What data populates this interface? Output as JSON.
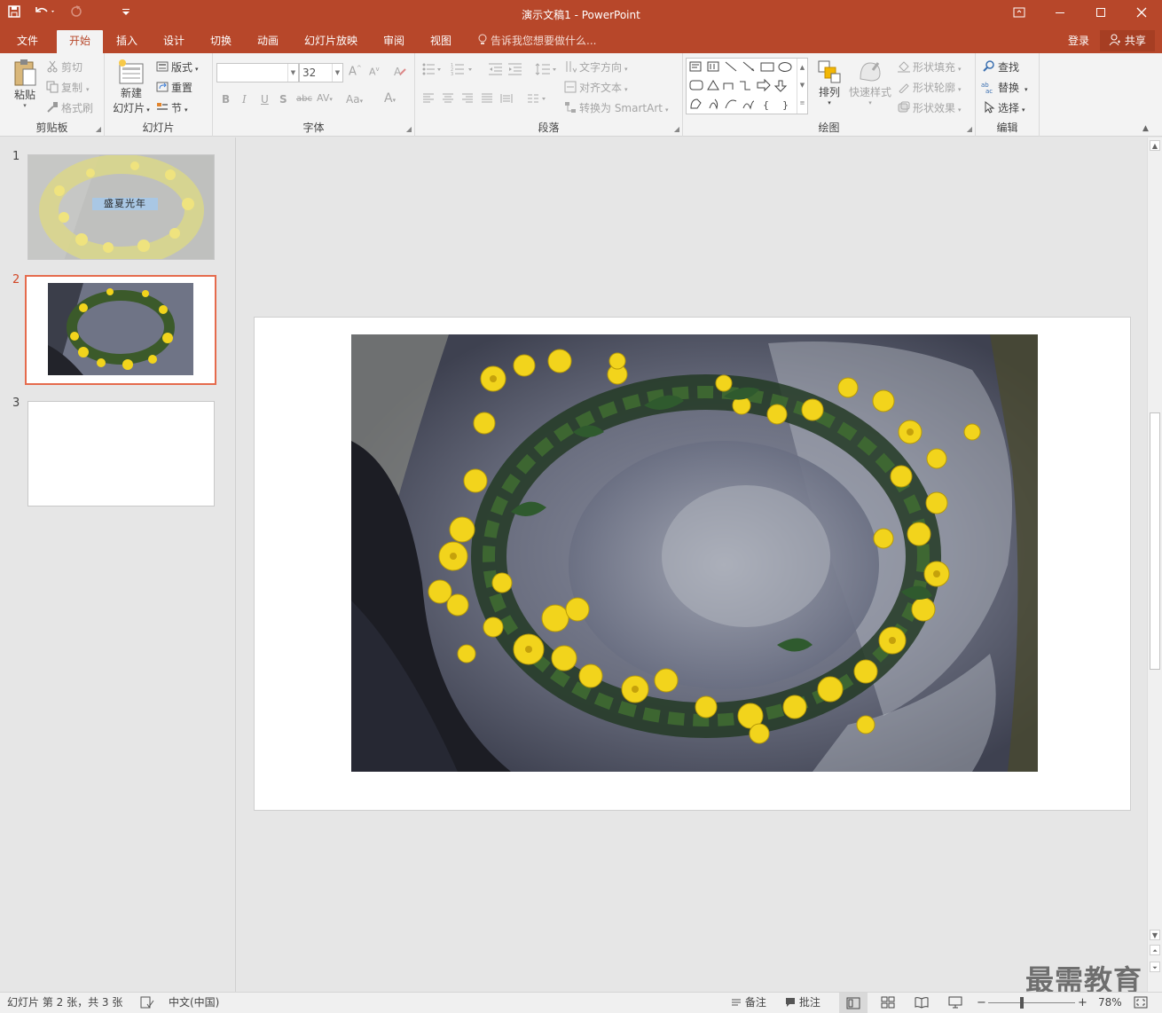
{
  "titlebar": {
    "title": "演示文稿1 - PowerPoint",
    "qat": [
      "save-icon",
      "undo-icon",
      "redo-icon",
      "customize-qat-icon"
    ],
    "window_buttons": [
      "ribbon-display-icon",
      "minimize-icon",
      "maximize-icon",
      "close-icon"
    ]
  },
  "tabs": {
    "items": [
      {
        "label": "文件",
        "active": false
      },
      {
        "label": "开始",
        "active": true
      },
      {
        "label": "插入",
        "active": false
      },
      {
        "label": "设计",
        "active": false
      },
      {
        "label": "切换",
        "active": false
      },
      {
        "label": "动画",
        "active": false
      },
      {
        "label": "幻灯片放映",
        "active": false
      },
      {
        "label": "审阅",
        "active": false
      },
      {
        "label": "视图",
        "active": false
      }
    ],
    "tell_me": "告诉我您想要做什么...",
    "login": "登录",
    "share": "共享"
  },
  "ribbon": {
    "clipboard": {
      "label": "剪贴板",
      "paste": "粘贴",
      "cut": "剪切",
      "copy": "复制",
      "format_painter": "格式刷"
    },
    "slides": {
      "label": "幻灯片",
      "new_slide_line1": "新建",
      "new_slide_line2": "幻灯片",
      "layout": "版式",
      "reset": "重置",
      "section": "节"
    },
    "font": {
      "label": "字体",
      "font_name": "",
      "font_size": "32"
    },
    "paragraph": {
      "label": "段落",
      "text_direction": "文字方向",
      "align_text": "对齐文本",
      "convert_smartart": "转换为 SmartArt"
    },
    "drawing": {
      "label": "绘图",
      "arrange": "排列",
      "quick_styles": "快速样式",
      "shape_fill": "形状填充",
      "shape_outline": "形状轮廓",
      "shape_effects": "形状效果"
    },
    "editing": {
      "label": "编辑",
      "find": "查找",
      "replace": "替换",
      "select": "选择"
    }
  },
  "thumbnails": {
    "slides": [
      {
        "number": "1",
        "title_text": "盛夏光年",
        "selected": false
      },
      {
        "number": "2",
        "selected": true
      },
      {
        "number": "3",
        "selected": false
      }
    ]
  },
  "statusbar": {
    "slide_info": "幻灯片 第 2 张，共 3 张",
    "language": "中文(中国)",
    "notes": "备注",
    "comments": "批注",
    "zoom": "78%",
    "zoom_fraction": 0.39
  },
  "watermark": "最需教育",
  "colors": {
    "accent": "#b7472a",
    "selection": "#e56b4d",
    "flower": "#f2d41c",
    "rock": "#6f7486"
  }
}
